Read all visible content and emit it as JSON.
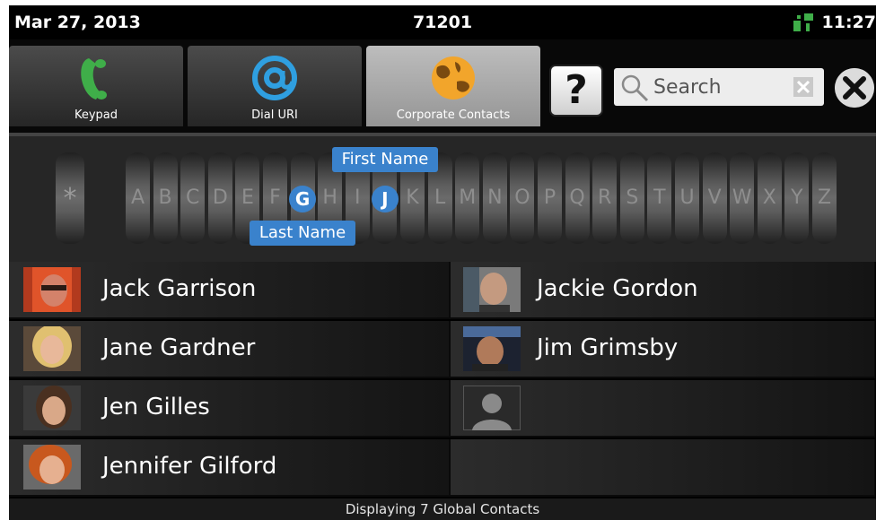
{
  "status": {
    "date": "Mar 27, 2013",
    "extension": "71201",
    "time": "11:27"
  },
  "tabs": [
    {
      "label": "Keypad",
      "icon": "phone-handset-icon"
    },
    {
      "label": "Dial URI",
      "icon": "at-sign-icon"
    },
    {
      "label": "Corporate Contacts",
      "icon": "globe-icon",
      "active": true
    }
  ],
  "help": {
    "label": "?"
  },
  "search": {
    "placeholder": "Search",
    "value": ""
  },
  "alphabet": {
    "wildcard": "*",
    "letters": [
      "A",
      "B",
      "C",
      "D",
      "E",
      "F",
      "G",
      "H",
      "I",
      "J",
      "K",
      "L",
      "M",
      "N",
      "O",
      "P",
      "Q",
      "R",
      "S",
      "T",
      "U",
      "V",
      "W",
      "X",
      "Y",
      "Z"
    ],
    "selected_last_name": "G",
    "selected_first_name": "J",
    "first_name_label": "First Name",
    "last_name_label": "Last Name"
  },
  "contacts": [
    {
      "name": "Jack Garrison"
    },
    {
      "name": "Jackie Gordon"
    },
    {
      "name": "Jane Gardner"
    },
    {
      "name": "Jim Grimsby"
    },
    {
      "name": "Jen Gilles"
    },
    {
      "name": ""
    },
    {
      "name": "Jennifer Gilford"
    }
  ],
  "footer": {
    "text": "Displaying 7 Global Contacts"
  },
  "colors": {
    "accent": "#3a82cc",
    "background": "#000000",
    "phone_icon": "#3fae49",
    "at_icon": "#2f9fe0",
    "globe_icon": "#f2a52b"
  }
}
